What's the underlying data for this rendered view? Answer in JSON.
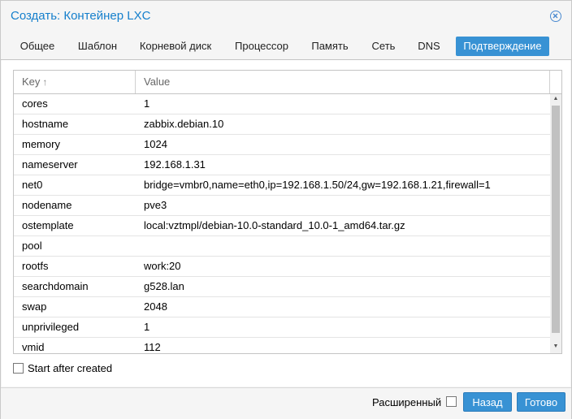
{
  "window": {
    "title": "Создать: Контейнер LXC"
  },
  "tabs": [
    {
      "label": "Общее"
    },
    {
      "label": "Шаблон"
    },
    {
      "label": "Корневой диск"
    },
    {
      "label": "Процессор"
    },
    {
      "label": "Память"
    },
    {
      "label": "Сеть"
    },
    {
      "label": "DNS"
    },
    {
      "label": "Подтверждение",
      "active": true
    }
  ],
  "grid": {
    "columns": {
      "key": "Key",
      "value": "Value"
    },
    "sort_icon": "sort-ascending-icon",
    "rows": [
      {
        "key": "cores",
        "value": "1"
      },
      {
        "key": "hostname",
        "value": "zabbix.debian.10"
      },
      {
        "key": "memory",
        "value": "1024"
      },
      {
        "key": "nameserver",
        "value": "192.168.1.31"
      },
      {
        "key": "net0",
        "value": "bridge=vmbr0,name=eth0,ip=192.168.1.50/24,gw=192.168.1.21,firewall=1"
      },
      {
        "key": "nodename",
        "value": "pve3"
      },
      {
        "key": "ostemplate",
        "value": "local:vztmpl/debian-10.0-standard_10.0-1_amd64.tar.gz"
      },
      {
        "key": "pool",
        "value": ""
      },
      {
        "key": "rootfs",
        "value": "work:20"
      },
      {
        "key": "searchdomain",
        "value": "g528.lan"
      },
      {
        "key": "swap",
        "value": "2048"
      },
      {
        "key": "unprivileged",
        "value": "1"
      },
      {
        "key": "vmid",
        "value": "112"
      }
    ]
  },
  "options": {
    "start_after_created": "Start after created"
  },
  "footer": {
    "advanced_label": "Расширенный",
    "back_label": "Назад",
    "finish_label": "Готово"
  },
  "colors": {
    "accent": "#3892d4",
    "title": "#157fcc"
  }
}
